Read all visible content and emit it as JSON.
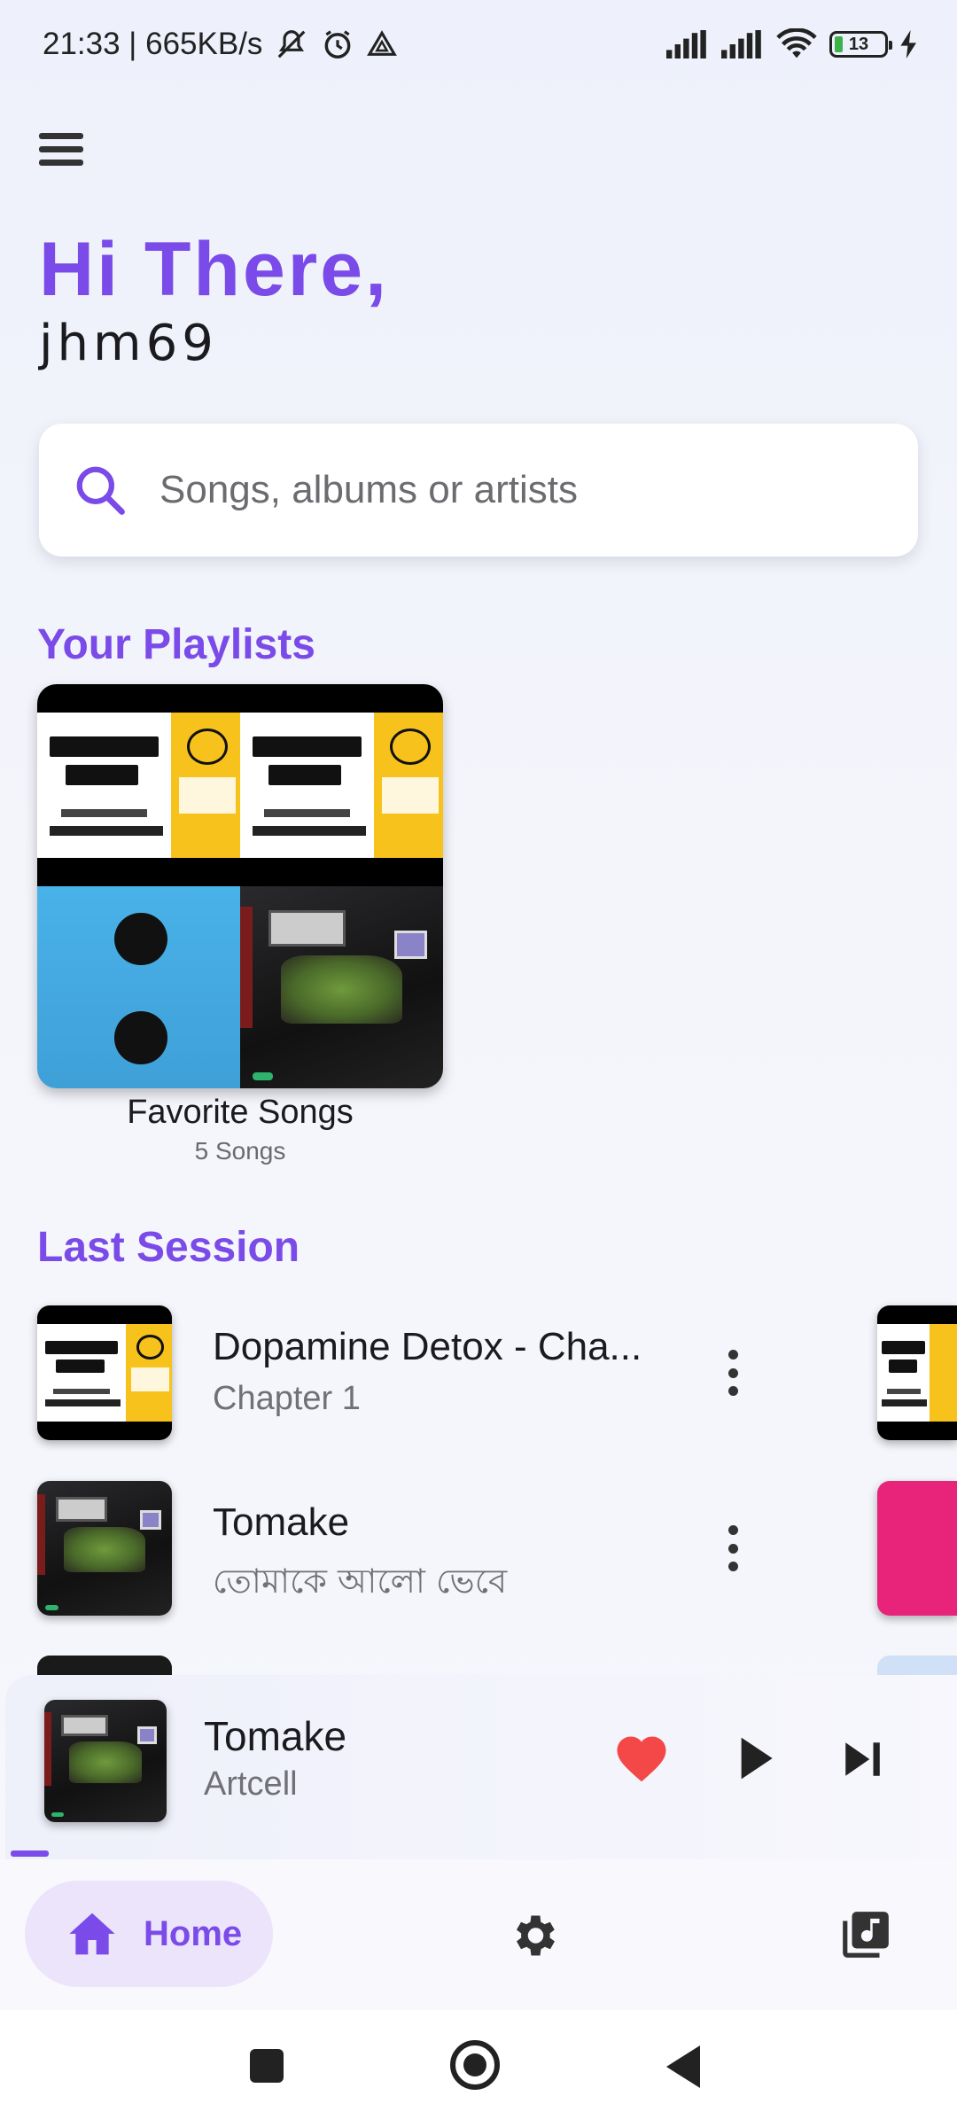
{
  "status_bar": {
    "time_speed": "21:33 | 665KB/s",
    "battery": "13",
    "icons": [
      "mute-icon",
      "alarm-icon",
      "drive-icon",
      "signal-icon",
      "signal-icon",
      "wifi-icon",
      "battery-icon",
      "charging-icon"
    ]
  },
  "header": {
    "greeting": "Hi There,",
    "username": "jhm69"
  },
  "search": {
    "placeholder": "Songs, albums or artists"
  },
  "playlists": {
    "section_title": "Your Playlists",
    "items": [
      {
        "name": "Favorite Songs",
        "count": "5 Songs"
      }
    ]
  },
  "last_session": {
    "section_title": "Last Session",
    "items": [
      {
        "title": "Dopamine Detox - Cha...",
        "subtitle": "Chapter 1"
      },
      {
        "title": "Tomake",
        "subtitle": "তোমাকে আলো ভেবে"
      }
    ]
  },
  "mini_player": {
    "title": "Tomake",
    "artist": "Artcell",
    "liked": true,
    "progress": 0.04
  },
  "bottom_nav": {
    "home_label": "Home"
  },
  "colors": {
    "accent": "#7a4be8",
    "heart": "#f44848"
  }
}
